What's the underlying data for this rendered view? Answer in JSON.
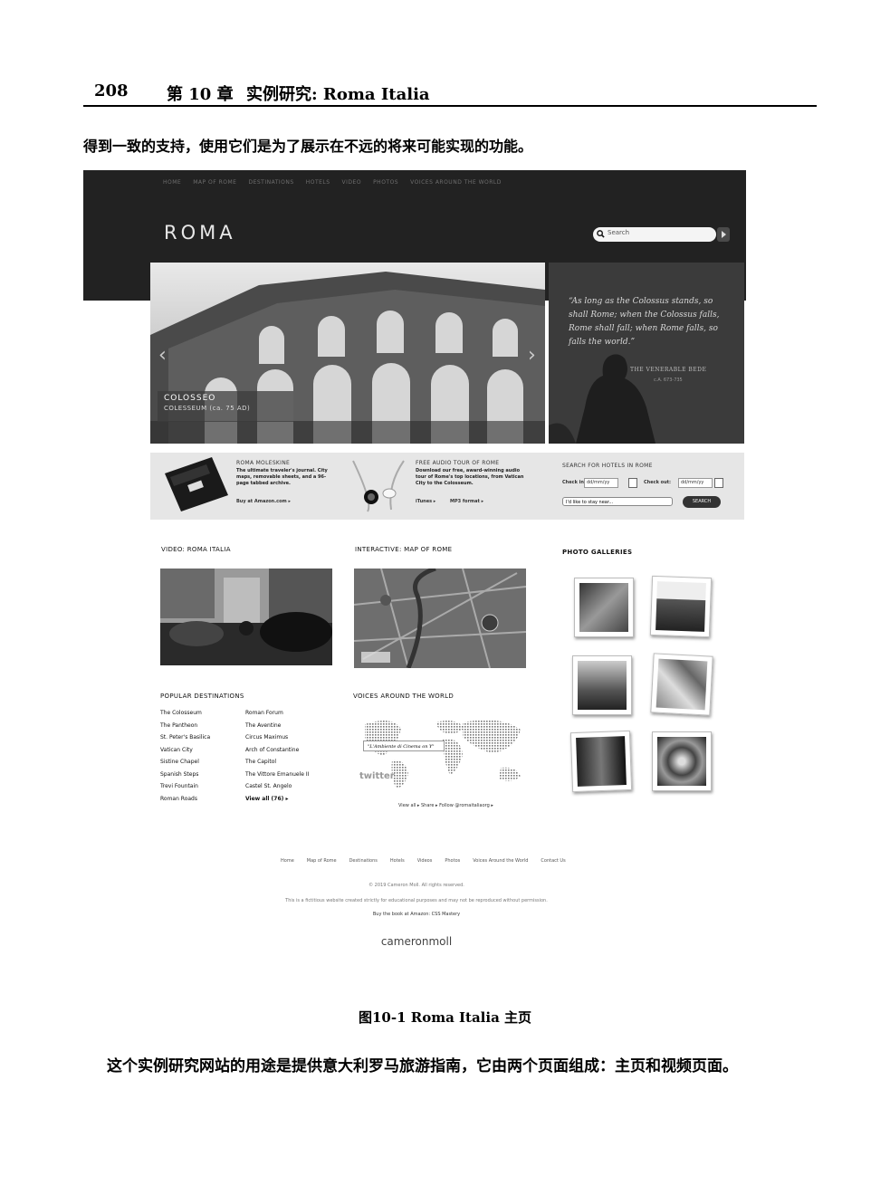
{
  "page_header": {
    "page_number": "208",
    "chapter": "第 10 章",
    "title": "实例研究: Roma Italia"
  },
  "intro_text": "得到一致的支持，使用它们是为了展示在不远的将来可能实现的功能。",
  "screenshot": {
    "nav": [
      "HOME",
      "MAP OF ROME",
      "DESTINATIONS",
      "HOTELS",
      "VIDEO",
      "PHOTOS",
      "VOICES AROUND THE WORLD"
    ],
    "logo": "ROMA",
    "search_placeholder": "Search",
    "hero": {
      "title": "COLOSSEO",
      "subtitle": "COLESSEUM (ca. 75 AD)"
    },
    "quote": {
      "text": "“As long as the Colossus stands, so shall Rome; when the Colossus falls, Rome shall fall; when Rome falls, so falls the world.”",
      "author": "THE VENERABLE BEDE",
      "date": "c.A. 673-735"
    },
    "promo": {
      "moleskine": {
        "title": "ROMA MOLESKINE",
        "text": "The ultimate traveler's journal. City maps, removable sheets, and a 96-page tabbed archive.",
        "link": "Buy at Amazon.com ▸"
      },
      "audio": {
        "title": "FREE AUDIO TOUR OF ROME",
        "text": "Download our free, award-winning audio tour of Rome's top locations, from Vatican City to the Colosseum.",
        "link1": "iTunes ▸",
        "link2": "MP3 format ▸"
      },
      "hotels": {
        "title": "SEARCH FOR HOTELS IN ROME",
        "checkin_label": "Check in:",
        "checkin_value": "dd/mm/yy",
        "checkout_label": "Check out:",
        "checkout_value": "dd/mm/yy",
        "stay_near": "I'd like to stay near...",
        "button": "SEARCH"
      }
    },
    "sections": {
      "video": "VIDEO: ROMA ITALIA",
      "map": "INTERACTIVE: MAP OF ROME",
      "photos": "PHOTO GALLERIES",
      "popular": "POPULAR DESTINATIONS",
      "voices": "VOICES AROUND THE WORLD"
    },
    "destinations_col1": [
      "The Colosseum",
      "The Pantheon",
      "St. Peter's Basilica",
      "Vatican City",
      "Sistine Chapel",
      "Spanish Steps",
      "Trevi Fountain",
      "Roman Roads"
    ],
    "destinations_col2": [
      "Roman Forum",
      "The Aventine",
      "Circus Maximus",
      "Arch of Constantine",
      "The Capitol",
      "The Vittore Emanuele II",
      "Castel St. Angelo",
      "View all (76) ▸"
    ],
    "voices_tip": "\"L'Ambiente di Cinema on Y\"",
    "twitter": "twitter",
    "voices_links": "View all ▸   Share ▸   Follow @romaitaliaorg ▸",
    "footer_nav": [
      "Home",
      "Map of Rome",
      "Destinations",
      "Hotels",
      "Videos",
      "Photos",
      "Voices Around the World",
      "Contact Us"
    ],
    "footer_copyright": "© 2019 Cameron Moll. All rights reserved.",
    "footer_disclaimer": "This is a fictitious website created strictly for educational purposes and may not be reproduced without permission.",
    "footer_book": "Buy the book at Amazon: CSS Mastery",
    "footer_logo": "cameronmoll"
  },
  "caption": "图10-1   Roma Italia 主页",
  "body_text": "这个实例研究网站的用途是提供意大利罗马旅游指南，它由两个页面组成：主页和视频页面。"
}
